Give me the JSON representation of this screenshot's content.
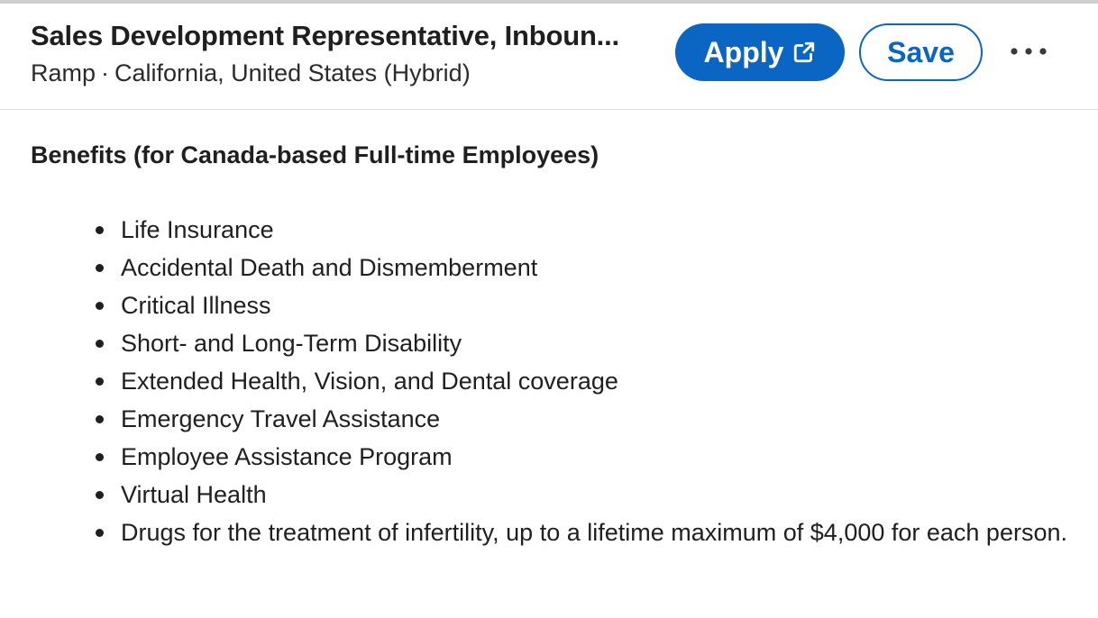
{
  "header": {
    "job_title": "Sales Development Representative, Inboun...",
    "company": "Ramp",
    "separator": "·",
    "location": "California, United States (Hybrid)",
    "apply_label": "Apply",
    "save_label": "Save",
    "more_icon": "more-horizontal-icon",
    "apply_icon": "external-link-icon"
  },
  "content": {
    "section_heading": "Benefits (for Canada-based Full-time Employees)",
    "benefits": [
      "Life Insurance",
      "Accidental Death and Dismemberment",
      "Critical Illness",
      "Short- and Long-Term Disability",
      "Extended Health, Vision, and Dental coverage",
      "Emergency Travel Assistance",
      "Employee Assistance Program",
      "Virtual Health",
      "Drugs for the treatment of infertility, up to a lifetime maximum of $4,000 for each person."
    ]
  },
  "colors": {
    "primary": "#0a66c2",
    "text": "#1f1f1f",
    "divider": "#dedede"
  }
}
